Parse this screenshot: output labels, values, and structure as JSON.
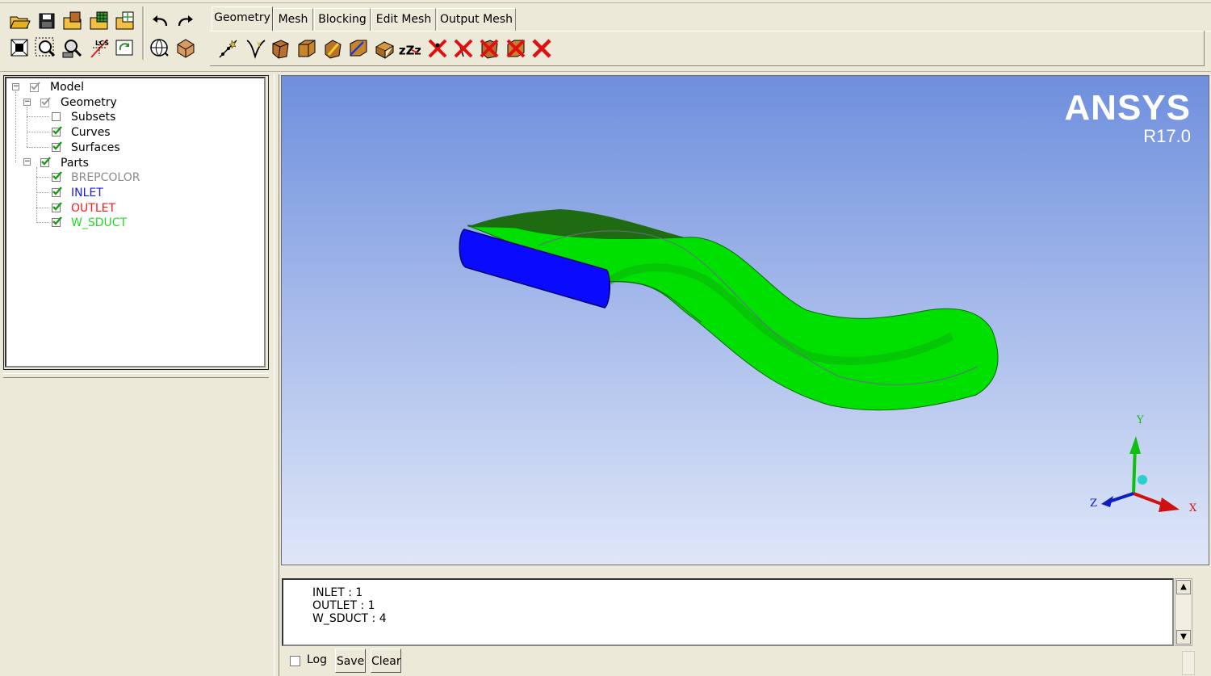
{
  "toolbar": {
    "row1_icons": [
      "open-icon",
      "save-icon",
      "save-geometry-icon",
      "save-mesh-icon",
      "save-blocking-icon",
      "undo-icon",
      "redo-icon"
    ],
    "row2_icons": [
      "fit-window-icon",
      "zoom-icon",
      "measure-icon",
      "local-coord-icon",
      "refresh-icon",
      "wireframe-icon",
      "solid-view-icon"
    ],
    "lcs_label": "LCS"
  },
  "tabs": [
    {
      "label": "Geometry",
      "active": true
    },
    {
      "label": "Mesh",
      "active": false
    },
    {
      "label": "Blocking",
      "active": false
    },
    {
      "label": "Edit Mesh",
      "active": false
    },
    {
      "label": "Output Mesh",
      "active": false
    }
  ],
  "geometry_tools": {
    "icons": [
      "create-point-icon",
      "create-curve-icon",
      "create-surface-icon",
      "create-body-icon",
      "repair-geometry-icon",
      "transform-geometry-icon",
      "restore-entities-icon",
      "delete-point-icon",
      "delete-curve-icon",
      "delete-surface-icon",
      "delete-body-icon",
      "delete-any-entity-icon"
    ],
    "sleep_label": "zZz"
  },
  "tree": {
    "model": "Model",
    "geometry": "Geometry",
    "subsets": "Subsets",
    "curves": "Curves",
    "surfaces": "Surfaces",
    "parts": "Parts",
    "part_items": [
      {
        "label": "BREPCOLOR",
        "color": "#8c8c8c"
      },
      {
        "label": "INLET",
        "color": "#1a1aff"
      },
      {
        "label": "OUTLET",
        "color": "#ff1a1a"
      },
      {
        "label": "W_SDUCT",
        "color": "#22dd22"
      }
    ]
  },
  "viewport": {
    "brand": "ANSYS",
    "version": "R17.0",
    "axis_x": "X",
    "axis_y": "Y",
    "axis_z": "Z",
    "colors": {
      "inlet": "#0000ff",
      "duct": "#00e000",
      "duct_top": "#1f6b12",
      "bg_top": "#6e8fdd",
      "bg_bottom": "#dfe7f8"
    }
  },
  "console": {
    "lines": [
      "INLET : 1",
      "OUTLET : 1",
      "W_SDUCT : 4"
    ],
    "log_label": "Log",
    "log_checked": false,
    "save_label": "Save",
    "clear_label": "Clear"
  }
}
